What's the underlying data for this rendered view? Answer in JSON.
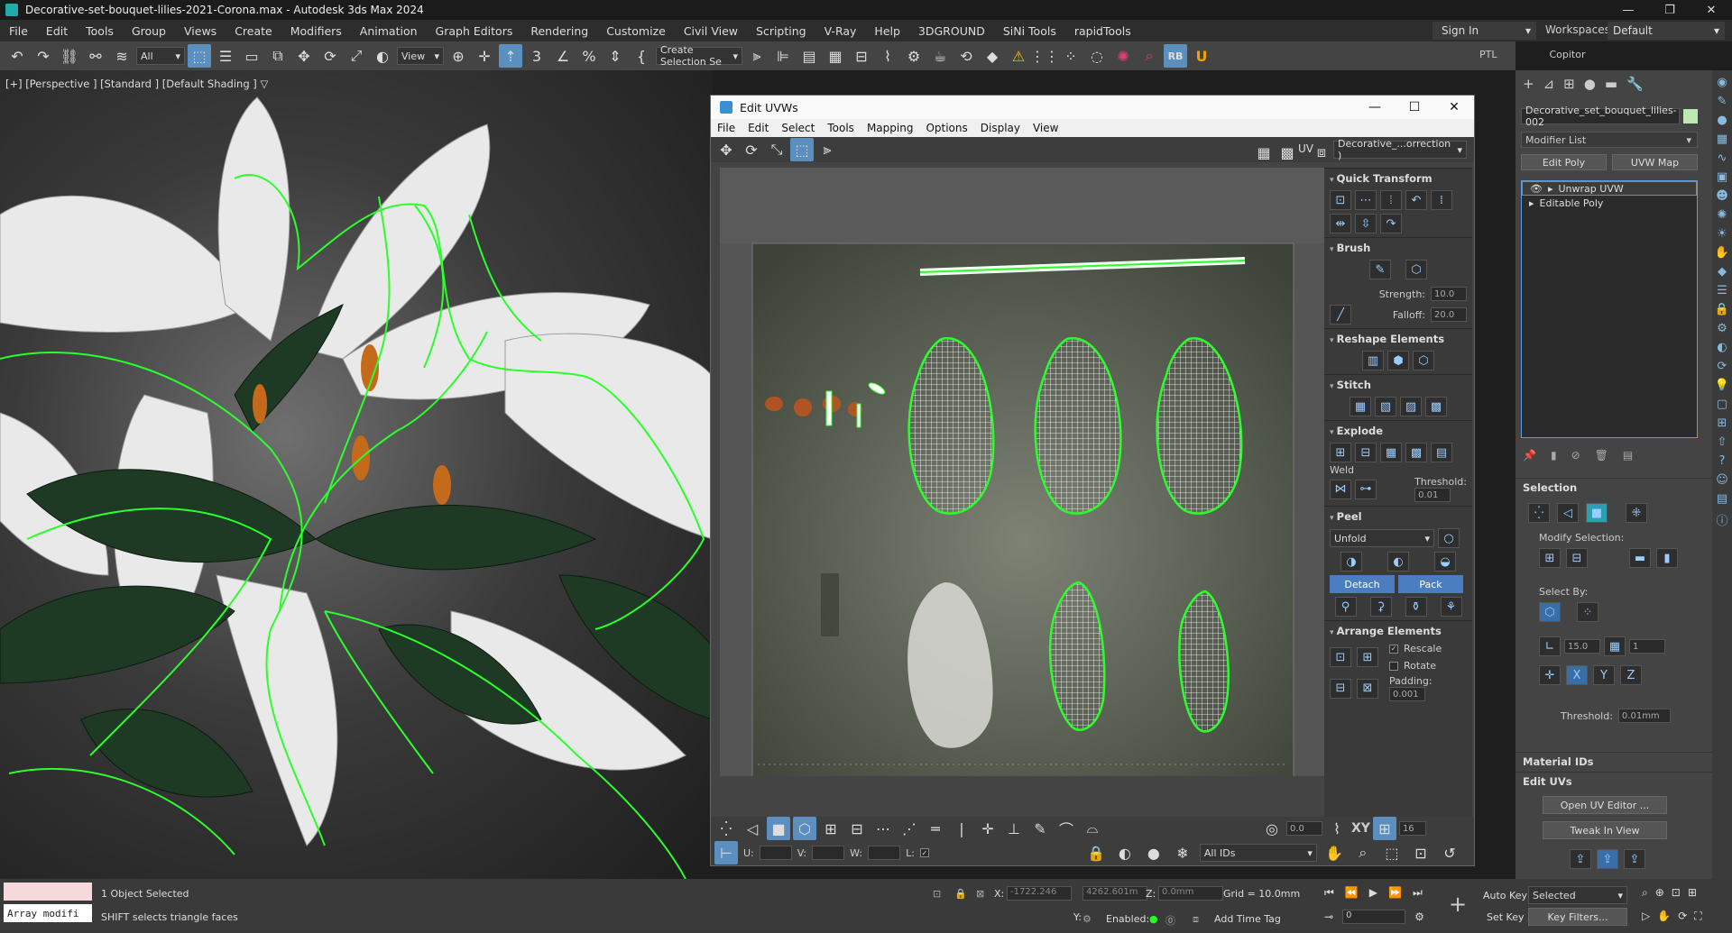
{
  "window": {
    "title": "Decorative-set-bouquet-lilies-2021-Corona.max - Autodesk 3ds Max 2024",
    "minimize": "—",
    "maximize": "❐",
    "close": "✕"
  },
  "menu": {
    "items": [
      "File",
      "Edit",
      "Tools",
      "Group",
      "Views",
      "Create",
      "Modifiers",
      "Animation",
      "Graph Editors",
      "Rendering",
      "Customize",
      "Civil View",
      "Scripting",
      "V-Ray",
      "Help",
      "3DGROUND",
      "SiNi Tools",
      "rapidTools"
    ],
    "sign_in": "Sign In",
    "workspaces_label": "Workspaces:",
    "workspace_value": "Default"
  },
  "toolbar": {
    "filter_value": "All",
    "view_value": "View",
    "selection_set_value": "Create Selection Se",
    "ptl_label": "PTL",
    "copitor_label": "Copitor"
  },
  "viewport": {
    "label": "[+] [Perspective ] [Standard ] [Default Shading ]",
    "filter_icon": "▽"
  },
  "uvw_editor": {
    "title": "Edit UVWs",
    "menu": [
      "File",
      "Edit",
      "Select",
      "Tools",
      "Mapping",
      "Options",
      "Display",
      "View"
    ],
    "uv_label": "UV",
    "map_dropdown": "Decorative_...orrection )",
    "sections": {
      "quick_transform": "Quick Transform",
      "brush": "Brush",
      "strength_label": "Strength:",
      "strength_value": "10.0",
      "falloff_label": "Falloff:",
      "falloff_value": "20.0",
      "reshape": "Reshape Elements",
      "stitch": "Stitch",
      "explode": "Explode",
      "weld_label": "Weld",
      "threshold_label": "Threshold:",
      "threshold_value": "0.01",
      "peel": "Peel",
      "unfold_value": "Unfold",
      "detach": "Detach",
      "pack": "Pack",
      "arrange": "Arrange Elements",
      "rescale": "Rescale",
      "rotate": "Rotate",
      "padding_label": "Padding:",
      "padding_value": "0.001"
    },
    "bottom": {
      "angle_value": "0.0",
      "xy_label": "XY",
      "snap_value": "16",
      "u_label": "U:",
      "v_label": "V:",
      "w_label": "W:",
      "l_label": "L:",
      "ids_value": "All IDs"
    }
  },
  "command_panel": {
    "object_name": "Decorative_set_bouquet_lilies-002",
    "object_color": "#bde8b4",
    "modifier_list": "Modifier List",
    "edit_poly_btn": "Edit Poly",
    "uvw_map_btn": "UVW Map",
    "stack": [
      "Unwrap UVW",
      "Editable Poly"
    ],
    "selection": "Selection",
    "modify_selection": "Modify Selection:",
    "select_by": "Select By:",
    "angle_value": "15.0",
    "count_value": "1",
    "threshold_label": "Threshold:",
    "threshold_value": "0.01mm",
    "material_ids": "Material IDs",
    "edit_uvs": "Edit UVs",
    "open_uv_editor": "Open UV Editor ...",
    "tweak_in_view": "Tweak In View"
  },
  "status": {
    "objects_selected": "1 Object Selected",
    "hint": "SHIFT selects triangle faces",
    "maxscript_text": "Array modifi",
    "x_label": "X:",
    "x_value": "-1722.246",
    "y_label": "Y:",
    "y_value": "4262.601m",
    "z_label": "Z:",
    "z_value": "0.0mm",
    "grid": "Grid = 10.0mm",
    "enabled_label": "Enabled:",
    "add_time_tag": "Add Time Tag",
    "auto_key": "Auto Key",
    "set_key": "Set Key",
    "selected_value": "Selected",
    "key_filters": "Key Filters...",
    "frame_value": "0"
  }
}
